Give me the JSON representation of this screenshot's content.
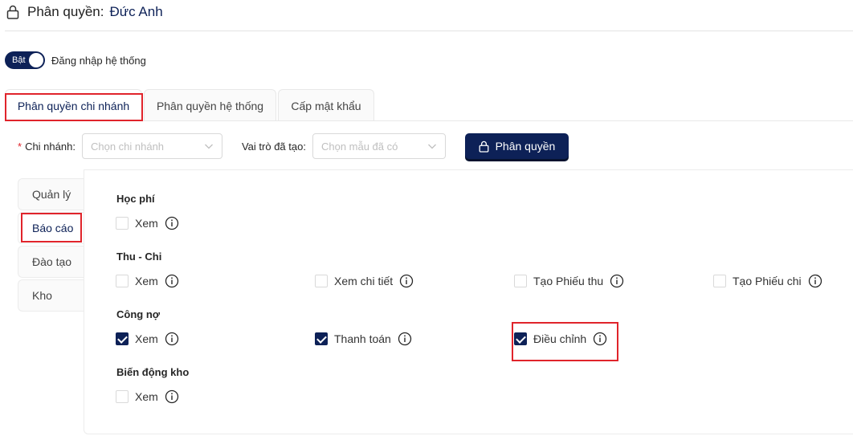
{
  "header": {
    "prefix": "Phân quyền:",
    "user_name": "Đức Anh"
  },
  "login": {
    "switch_label": "Bật",
    "switch_on": true,
    "label": "Đăng nhập hệ thống"
  },
  "tabs": [
    {
      "label": "Phân quyền chi nhánh",
      "active": true
    },
    {
      "label": "Phân quyền hệ thống",
      "active": false
    },
    {
      "label": "Cấp mật khẩu",
      "active": false
    }
  ],
  "filters": {
    "required_mark": "*",
    "branch": {
      "label": "Chi nhánh",
      "colon": ":",
      "placeholder": "Chọn chi nhánh"
    },
    "role": {
      "label": "Vai trò đã tạo",
      "colon": ":",
      "placeholder": "Chọn mẫu đã có"
    },
    "button_label": "Phân quyền"
  },
  "side_tabs": [
    {
      "label": "Quản lý",
      "active": false
    },
    {
      "label": "Báo cáo",
      "active": true
    },
    {
      "label": "Đào tạo",
      "active": false
    },
    {
      "label": "Kho",
      "active": false
    }
  ],
  "groups": [
    {
      "title": "Học phí",
      "perms": [
        {
          "label": "Xem",
          "checked": false
        }
      ]
    },
    {
      "title": "Thu - Chi",
      "perms": [
        {
          "label": "Xem",
          "checked": false
        },
        {
          "label": "Xem chi tiết",
          "checked": false
        },
        {
          "label": "Tạo Phiếu thu",
          "checked": false
        },
        {
          "label": "Tạo Phiếu chi",
          "checked": false
        }
      ]
    },
    {
      "title": "Công nợ",
      "perms": [
        {
          "label": "Xem",
          "checked": true
        },
        {
          "label": "Thanh toán",
          "checked": true
        },
        {
          "label": "Điều chỉnh",
          "checked": true
        }
      ]
    },
    {
      "title": "Biến động kho",
      "perms": [
        {
          "label": "Xem",
          "checked": false
        }
      ]
    }
  ],
  "colors": {
    "primary": "#0d2157",
    "highlight": "#e0242b",
    "required": "#e0242b"
  }
}
